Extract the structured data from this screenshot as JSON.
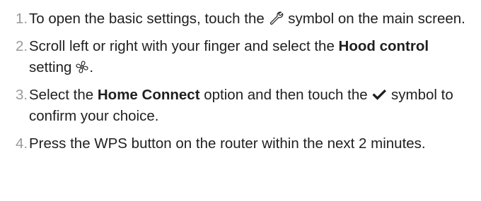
{
  "steps": [
    {
      "number": "1.",
      "parts": {
        "a": "To open the basic settings, touch the",
        "icon": "wrench-icon",
        "b": "symbol on the main screen."
      }
    },
    {
      "number": "2.",
      "parts": {
        "a": "Scroll left or right with your finger and select the",
        "bold": "Hood control",
        "b": "setting",
        "icon": "fan-icon",
        "c": "."
      }
    },
    {
      "number": "3.",
      "parts": {
        "a": "Select the",
        "bold": "Home Connect",
        "b": "option and then touch the",
        "icon": "checkmark-icon",
        "c": "symbol to confirm your choice."
      }
    },
    {
      "number": "4.",
      "parts": {
        "a": "Press the WPS button on the router within the next 2 minutes."
      }
    }
  ],
  "colors": {
    "text": "#1f1f1f",
    "number": "#9a9a9a"
  }
}
